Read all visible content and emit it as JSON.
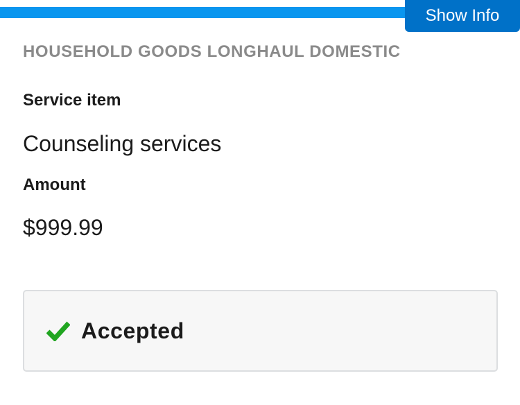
{
  "header": {
    "show_info_label": "Show Info"
  },
  "shipment": {
    "type": "HOUSEHOLD GOODS LONGHAUL DOMESTIC"
  },
  "service_item": {
    "label": "Service item",
    "value": "Counseling services"
  },
  "amount": {
    "label": "Amount",
    "value": "$999.99"
  },
  "status": {
    "icon": "check-icon",
    "text": "Accepted"
  },
  "colors": {
    "top_bar": "#0a96ef",
    "button": "#0071c8",
    "accepted_check": "#21a521",
    "status_background": "#f7f7f7",
    "status_border": "#dcdee0"
  }
}
